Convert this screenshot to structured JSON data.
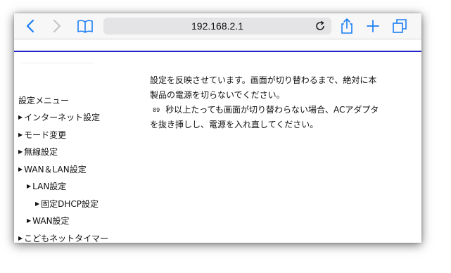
{
  "browser": {
    "url": "192.168.2.1",
    "icons": {
      "back": "chevron-left-icon",
      "forward": "chevron-right-icon",
      "bookmarks": "book-icon",
      "reload": "reload-icon",
      "share": "share-icon",
      "new_tab": "plus-icon",
      "tabs": "tabs-icon"
    },
    "accent": "#1a7ef5",
    "disabled": "#c4c4c4"
  },
  "page": {
    "rule_color": "#1e22c8",
    "menu": {
      "title": "設定メニュー",
      "items": [
        {
          "label": "インターネット設定",
          "level": 0
        },
        {
          "label": "モード変更",
          "level": 0
        },
        {
          "label": "無線設定",
          "level": 0
        },
        {
          "label": "WAN＆LAN設定",
          "level": 0
        },
        {
          "label": "LAN設定",
          "level": 1
        },
        {
          "label": "固定DHCP設定",
          "level": 2
        },
        {
          "label": "WAN設定",
          "level": 1
        },
        {
          "label": "こどもネットタイマー",
          "level": 0
        }
      ]
    },
    "message": {
      "line1": "設定を反映させています。画面が切り替わるまで、絶対に本",
      "line2": "製品の電源を切らないでください。",
      "countdown": "89",
      "line3": "秒以上たっても画面が切り替わらない場合、ACアダプタ",
      "line4": "を抜き挿しし、電源を入れ直してください。"
    }
  }
}
